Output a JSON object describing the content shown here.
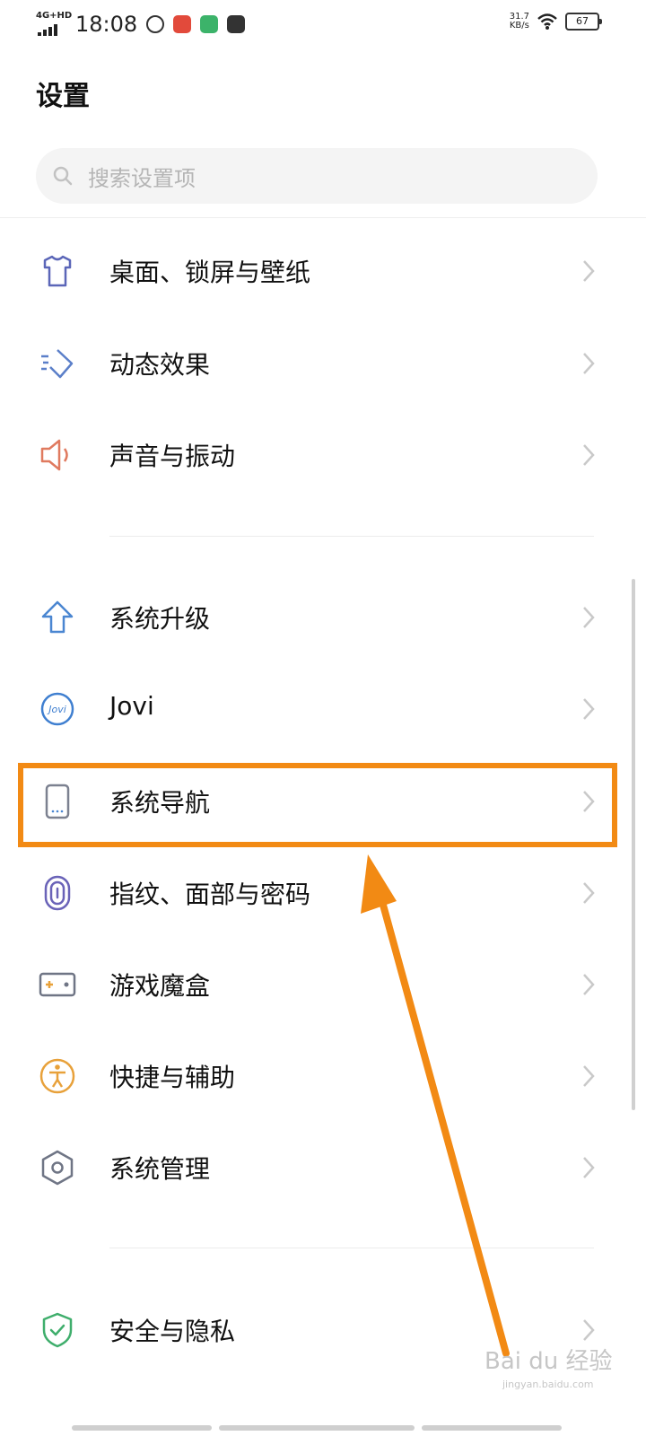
{
  "status_bar": {
    "network": "4G+HD",
    "time": "18:08",
    "speed_value": "31.7",
    "speed_unit": "KB/s",
    "battery": "67"
  },
  "page_title": "设置",
  "search": {
    "placeholder": "搜索设置项"
  },
  "items": [
    {
      "label": "桌面、锁屏与壁纸",
      "icon": "tshirt-icon",
      "color": "#5b66b8"
    },
    {
      "label": "动态效果",
      "icon": "motion-effect-icon",
      "color": "#5b7fc9"
    },
    {
      "label": "声音与振动",
      "icon": "speaker-icon",
      "color": "#e07a5f"
    },
    {
      "label": "系统升级",
      "icon": "upgrade-arrow-icon",
      "color": "#4a86d1"
    },
    {
      "label": "Jovi",
      "icon": "jovi-icon",
      "color": "#3f7fd0"
    },
    {
      "label": "系统导航",
      "icon": "phone-navigation-icon",
      "color": "#7c8190"
    },
    {
      "label": "指纹、面部与密码",
      "icon": "fingerprint-icon",
      "color": "#6a63b8"
    },
    {
      "label": "游戏魔盒",
      "icon": "gamepad-icon",
      "color": "#6f7585"
    },
    {
      "label": "快捷与辅助",
      "icon": "accessibility-icon",
      "color": "#e8a13a"
    },
    {
      "label": "系统管理",
      "icon": "hexagon-settings-icon",
      "color": "#6f7585"
    },
    {
      "label": "安全与隐私",
      "icon": "shield-check-icon",
      "color": "#3fae6c"
    }
  ],
  "highlight_color": "#f28a14",
  "watermark": {
    "brand": "Bai du 经验",
    "url": "jingyan.baidu.com"
  }
}
